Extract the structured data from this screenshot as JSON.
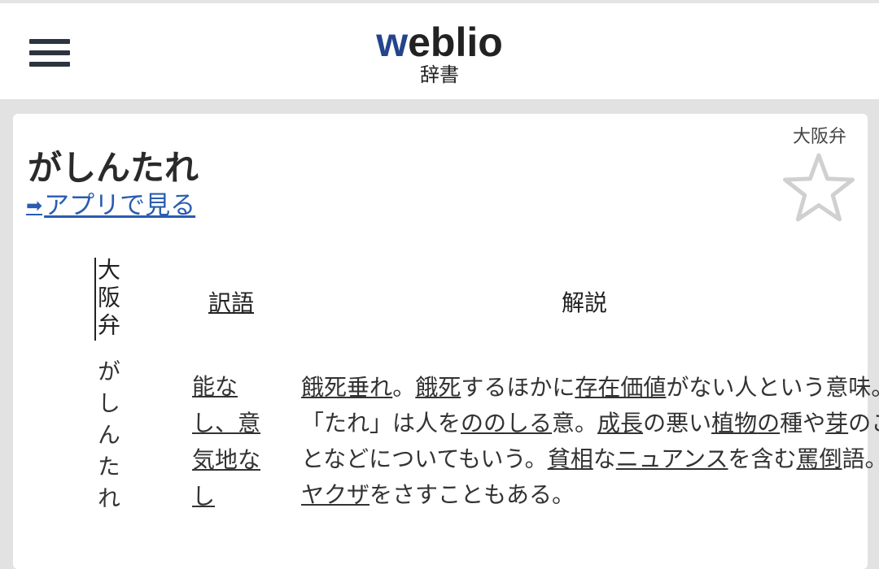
{
  "header": {
    "logo_w": "w",
    "logo_rest": "eblio",
    "logo_sub": "辞書"
  },
  "entry": {
    "dialect_tag": "大阪弁",
    "headword": "がしんたれ",
    "app_link_arrow": "➡",
    "app_link_text": "アプリで見る",
    "table": {
      "col_dialect": "大阪弁",
      "col_translation": "訳語",
      "col_description": "解説",
      "word": "がしんたれ",
      "translation": "能なし、意気地なし",
      "description_segments": [
        {
          "text": "餓死垂れ",
          "link": true
        },
        {
          "text": "。",
          "link": false
        },
        {
          "text": "餓死",
          "link": true
        },
        {
          "text": "するほかに",
          "link": false
        },
        {
          "text": "存在価値",
          "link": true
        },
        {
          "text": "がない人という意味。「たれ」は人を",
          "link": false
        },
        {
          "text": "ののしる",
          "link": true
        },
        {
          "text": "意。",
          "link": false
        },
        {
          "text": "成長",
          "link": true
        },
        {
          "text": "の悪い",
          "link": false
        },
        {
          "text": "植物",
          "link": true
        },
        {
          "text": "の",
          "link": true
        },
        {
          "text": "種や",
          "link": false
        },
        {
          "text": "芽",
          "link": true
        },
        {
          "text": "のことなどについてもいう。",
          "link": false
        },
        {
          "text": "貧相",
          "link": true
        },
        {
          "text": "な",
          "link": false
        },
        {
          "text": "ニュアンス",
          "link": true
        },
        {
          "text": "を含む",
          "link": false
        },
        {
          "text": "罵倒",
          "link": true
        },
        {
          "text": "語。",
          "link": false
        },
        {
          "text": "ヤクザ",
          "link": true
        },
        {
          "text": "をさすこともある。",
          "link": false
        }
      ]
    }
  },
  "colors": {
    "brand_blue": "#24448c",
    "link_blue": "#2a5cb0",
    "page_bg": "#e2e2e2"
  },
  "icons": {
    "menu": "hamburger-menu-icon",
    "favorite": "star-outline-icon",
    "arrow": "right-arrow-icon"
  }
}
